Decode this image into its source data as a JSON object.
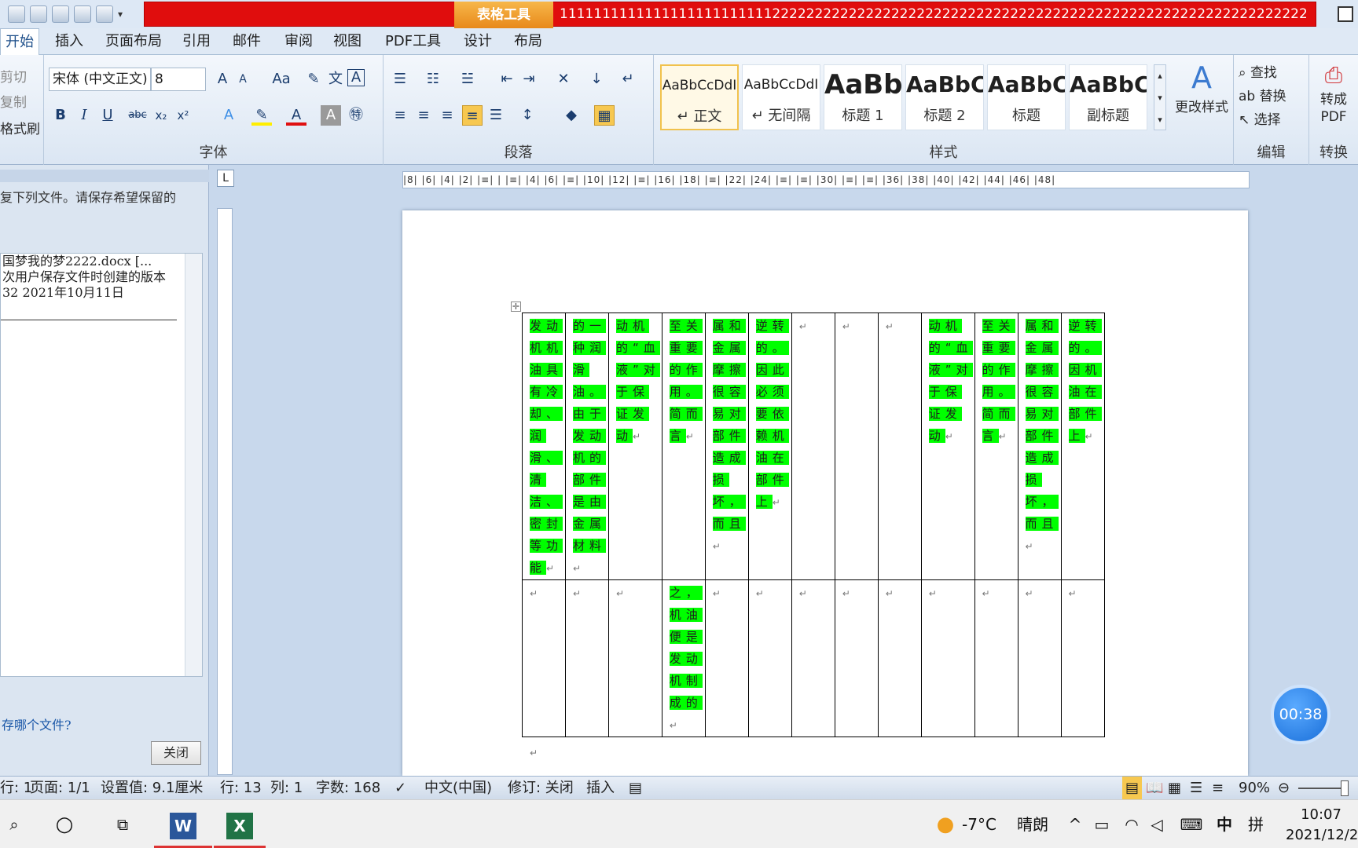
{
  "window": {
    "context_tab": "表格工具",
    "doc_title": "11111111111111111111111112222222222222222222222222222222222222222222222222222222222222222222..."
  },
  "tabs": [
    "开始",
    "插入",
    "页面布局",
    "引用",
    "邮件",
    "审阅",
    "视图",
    "PDF工具",
    "设计",
    "布局"
  ],
  "ribbon": {
    "clipboard": {
      "cut": "剪切",
      "copy": "复制",
      "format_painter": "格式刷"
    },
    "font": {
      "name": "宋体 (中文正文)",
      "size": "8",
      "label": "字体"
    },
    "paragraph": {
      "label": "段落"
    },
    "styles": {
      "label": "样式",
      "items": [
        {
          "sample": "AaBbCcDdI",
          "name": "↵ 正文"
        },
        {
          "sample": "AaBbCcDdI",
          "name": "↵ 无间隔"
        },
        {
          "sample": "AaBb",
          "name": "标题 1"
        },
        {
          "sample": "AaBbC",
          "name": "标题 2"
        },
        {
          "sample": "AaBbC",
          "name": "标题"
        },
        {
          "sample": "AaBbC",
          "name": "副标题"
        }
      ],
      "change_styles": "更改样式"
    },
    "editing": {
      "find": "查找",
      "replace": "替换",
      "select": "选择",
      "label": "编辑"
    },
    "convert": {
      "to_pdf": "转成 PDF",
      "label": "转换"
    }
  },
  "left_pane": {
    "message": "复下列文件。请保存希望保留的",
    "file_lines": [
      "国梦我的梦2222.docx  [...",
      "次用户保存文件时创建的版本",
      "32  2021年10月11日"
    ],
    "question": "存哪个文件?",
    "close": "关闭"
  },
  "ruler": {
    "marks": "|8| |6| |4| |2| |≡| | |≡| |4| |6| |≡| |10| |12| |≡| |16| |18| |≡| |22| |24| |≡| |≡| |30| |≡| |≡| |36| |38| |40| |42| |44| |46| |48|"
  },
  "table": {
    "row1": [
      "发动机机油具有冷却、润滑、清洁、密封等功能",
      "的一种润滑油。由于发动机的部件是由金属材料",
      "动机的“血液”对于保证发动",
      "至关重要的作用。简而言",
      "属和金属摩擦很容易对部件造成损坏，而且",
      "逆转的。因此必须要依赖机油在部件上",
      "",
      "",
      "",
      "动机的“血液”对于保证发动",
      "至关重要的作用。简而言",
      "属和金属摩擦很容易对部件造成损坏，而且",
      "逆转的。因机油在部件上"
    ],
    "row2": [
      "",
      "",
      "",
      "之，机油便是发动机制成的",
      "",
      "",
      "",
      "",
      "",
      "",
      "",
      "",
      ""
    ]
  },
  "timer": "00:38",
  "status": {
    "line_partial": "行: 1",
    "page": "页面: 1/1",
    "setting": "设置值: 9.1厘米",
    "row": "行: 13",
    "col": "列: 1",
    "words": "字数: 168",
    "language": "中文(中国)",
    "revisions": "修订: 关闭",
    "mode": "插入",
    "zoom": "90%"
  },
  "taskbar": {
    "weather_temp": "-7°C",
    "weather_text": "晴朗",
    "ime": "中",
    "ime2": "拼",
    "time": "10:07",
    "date": "2021/12/2"
  }
}
